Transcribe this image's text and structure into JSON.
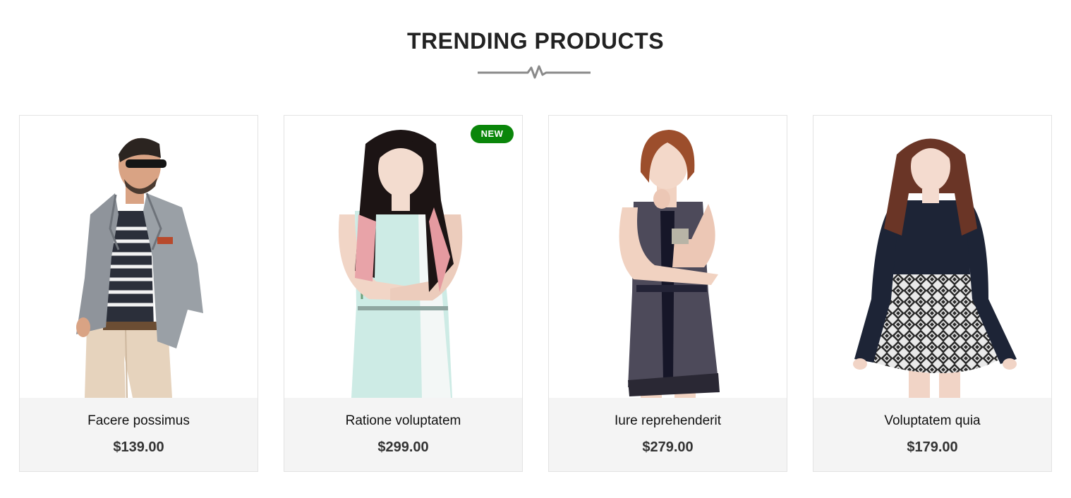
{
  "section": {
    "title": "TRENDING PRODUCTS"
  },
  "products": [
    {
      "name": "Facere possimus",
      "price": "$139.00",
      "badge": ""
    },
    {
      "name": "Ratione voluptatem",
      "price": "$299.00",
      "badge": "NEW"
    },
    {
      "name": "Iure reprehenderit",
      "price": "$279.00",
      "badge": ""
    },
    {
      "name": "Voluptatem quia",
      "price": "$179.00",
      "badge": ""
    }
  ],
  "colors": {
    "badge_bg": "#0a860a",
    "info_bg": "#f4f4f4",
    "divider": "#8a8a8a"
  }
}
